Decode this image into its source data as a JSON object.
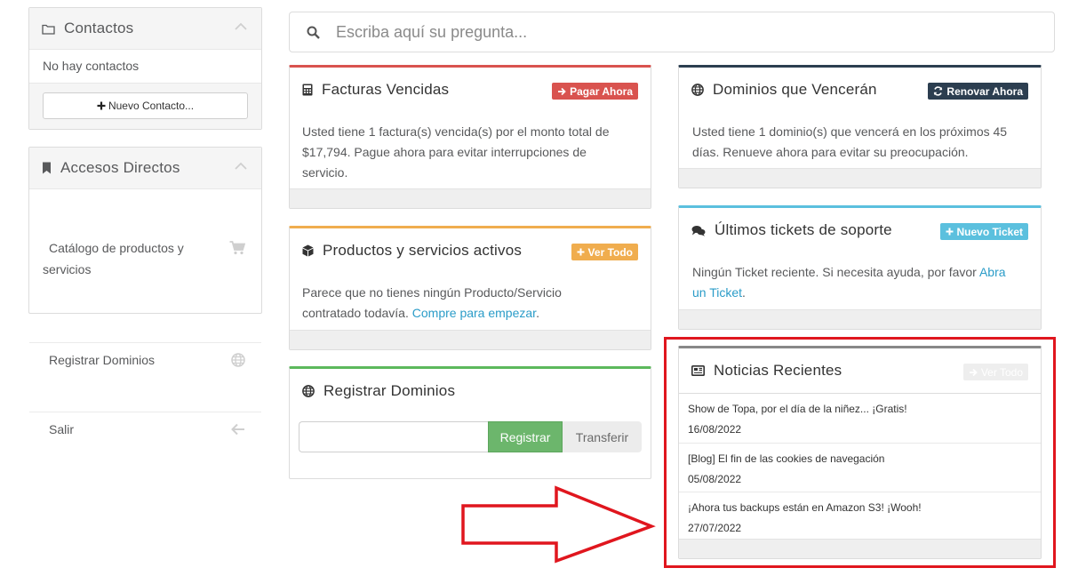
{
  "sidebar": {
    "contacts": {
      "title": "Contactos",
      "empty_text": "No hay contactos",
      "new_button": "Nuevo Contacto..."
    },
    "shortcuts": {
      "title": "Accesos Directos",
      "items": [
        {
          "label_line1": "Catálogo de productos y",
          "label_line2": "servicios",
          "icon": "cart-icon"
        },
        {
          "label": "Registrar Dominios",
          "icon": "globe-icon"
        },
        {
          "label": "Salir",
          "icon": "arrow-left-icon"
        }
      ]
    }
  },
  "search": {
    "placeholder": "Escriba aquí su pregunta..."
  },
  "panels": {
    "invoices": {
      "title": "Facturas Vencidas",
      "badge": "Pagar Ahora",
      "body": [
        "Usted tiene 1 factura(s) vencida(s) por el monto total de",
        "$17,794. Pague ahora para evitar interrupciones de",
        "servicio."
      ],
      "accent": "#d9534f"
    },
    "products": {
      "title": "Productos y servicios activos",
      "badge": "Ver Todo",
      "body_line1": "Parece que no tienes ningún Producto/Servicio",
      "body_line2_text": "contratado todavía. ",
      "body_line2_link": "Compre para empezar",
      "body_line2_end": ".",
      "accent": "#f0ad4e"
    },
    "register": {
      "title": "Registrar Dominios",
      "register_button": "Registrar",
      "transfer_button": "Transferir",
      "accent": "#5cb85c"
    },
    "domains": {
      "title": "Dominios que Vencerán",
      "badge": "Renovar Ahora",
      "body": [
        "Usted tiene 1 dominio(s) que vencerá en los próximos 45",
        "días. Renueve ahora para evitar su preocupación."
      ],
      "accent": "#2c3e50"
    },
    "tickets": {
      "title": "Últimos tickets de soporte",
      "badge": "Nuevo Ticket",
      "body_line1_text": "Ningún Ticket reciente. Si necesita ayuda, por favor ",
      "body_line1_link": "Abra",
      "body_line2_link": "un Ticket",
      "body_line2_end": ".",
      "accent": "#5bc0de"
    },
    "news": {
      "title": "Noticias Recientes",
      "badge": "Ver Todo",
      "items": [
        {
          "title": "Show de Topa, por el día de la niñez... ¡Gratis!",
          "date": "16/08/2022"
        },
        {
          "title": "[Blog] El fin de las cookies de navegación",
          "date": "05/08/2022"
        },
        {
          "title": "¡Ahora tus backups están en Amazon S3! ¡Wooh!",
          "date": "27/07/2022"
        }
      ],
      "accent": "#888888"
    }
  },
  "colors": {
    "highlight_red": "#e0161e",
    "badge_green": "#f0ad4e",
    "badge_info": "#5bc0de",
    "badge_dark": "#2c3e50",
    "badge_danger": "#d9534f",
    "link": "#2b9cc8"
  }
}
